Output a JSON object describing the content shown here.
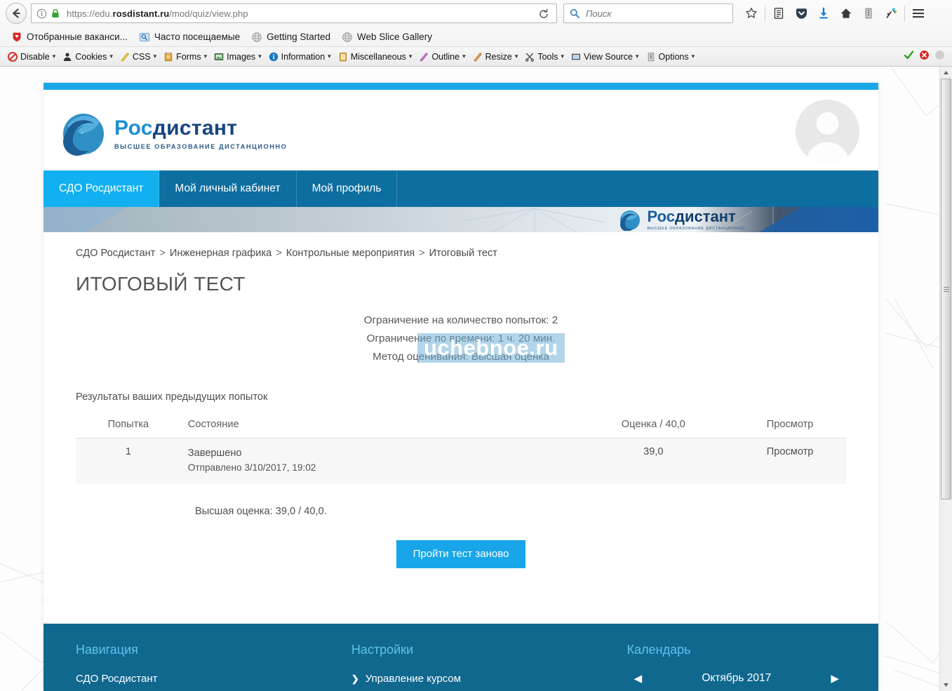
{
  "browser": {
    "back_tooltip": "Назад",
    "url_display_prefix": "https://edu.",
    "url_display_domain": "rosdistant.ru",
    "url_display_suffix": "/mod/quiz/view.php",
    "url_full": "https://edu.rosdistant.ru/mod/quiz/view.php",
    "search_placeholder": "Поиск",
    "reload_icon": "reload-icon",
    "info_icon": "page-info-icon",
    "lock_icon": "lock-icon",
    "search_icon": "search-icon",
    "toolbar_icons": [
      {
        "name": "bookmark-star-icon",
        "label": "Закладки"
      },
      {
        "name": "reading-list-icon",
        "label": "Список для чтения"
      },
      {
        "name": "pocket-icon",
        "label": "Pocket"
      },
      {
        "name": "downloads-icon",
        "label": "Загрузки"
      },
      {
        "name": "home-icon",
        "label": "Домой"
      },
      {
        "name": "library-icon",
        "label": "Библиотека"
      },
      {
        "name": "devtools-icon",
        "label": "Инструменты"
      },
      {
        "name": "hamburger-menu-icon",
        "label": "Меню"
      }
    ],
    "bookmarks": [
      {
        "label": "Отобранные ваканси...",
        "icon": "shield-red-icon"
      },
      {
        "label": "Часто посещаемые",
        "icon": "folder-blue-icon"
      },
      {
        "label": "Getting Started",
        "icon": "globe-icon"
      },
      {
        "label": "Web Slice Gallery",
        "icon": "globe-icon"
      }
    ],
    "devtools": [
      {
        "label": "Disable",
        "icon": "disable-icon",
        "caret": "▾"
      },
      {
        "label": "Cookies",
        "icon": "cookies-icon",
        "caret": "▾"
      },
      {
        "label": "CSS",
        "icon": "css-icon",
        "caret": "▾"
      },
      {
        "label": "Forms",
        "icon": "forms-icon",
        "caret": "▾"
      },
      {
        "label": "Images",
        "icon": "images-icon",
        "caret": "▾"
      },
      {
        "label": "Information",
        "icon": "information-icon",
        "caret": "▾"
      },
      {
        "label": "Miscellaneous",
        "icon": "miscellaneous-icon",
        "caret": "▾"
      },
      {
        "label": "Outline",
        "icon": "outline-icon",
        "caret": "▾"
      },
      {
        "label": "Resize",
        "icon": "resize-icon",
        "caret": "▾"
      },
      {
        "label": "Tools",
        "icon": "tools-icon",
        "caret": "▾"
      },
      {
        "label": "View Source",
        "icon": "view-source-icon",
        "caret": "▾"
      },
      {
        "label": "Options",
        "icon": "options-icon",
        "caret": "▾"
      }
    ],
    "status_icons": [
      {
        "name": "validation-pass-icon",
        "color": "#2f9e28"
      },
      {
        "name": "validation-error-icon",
        "color": "#d8221f"
      },
      {
        "name": "validation-idle-icon",
        "color": "#c9c9c9"
      }
    ]
  },
  "site": {
    "logo": {
      "name_part1": "Рос",
      "name_part2": "дистант",
      "tagline": "ВЫСШЕЕ ОБРАЗОВАНИЕ ДИСТАНЦИОННО"
    },
    "avatar_icon": "user-avatar-icon",
    "tabs": [
      {
        "label": "СДО Росдистант",
        "active": true
      },
      {
        "label": "Мой личный кабинет",
        "active": false
      },
      {
        "label": "Мой профиль",
        "active": false
      }
    ],
    "banner": {
      "name_part1": "Рос",
      "name_part2": "дистант",
      "tagline": "ВЫСШЕЕ ОБРАЗОВАНИЕ ДИСТАНЦИОННО"
    }
  },
  "breadcrumb": [
    "СДО Росдистант",
    "Инженерная графика",
    "Контрольные мероприятия",
    "Итоговый тест"
  ],
  "breadcrumb_separator": ">",
  "page": {
    "title": "ИТОГОВЫЙ ТЕСТ",
    "info_attempts": "Ограничение на количество попыток: 2",
    "info_time": "Ограничение по времени: 1 ч. 20 мин.",
    "info_method": "Метод оценивания: Высшая оценка",
    "results_label": "Результаты ваших предыдущих попыток",
    "best_grade": "Высшая оценка: 39,0 / 40,0.",
    "retake_button": "Пройти тест заново"
  },
  "watermark": {
    "text": "uchebnoe.ru",
    "band_color": "#6eafd7",
    "text_color": "#ffffff"
  },
  "attempts_table": {
    "headers": [
      "Попытка",
      "Состояние",
      "Оценка / 40,0",
      "Просмотр"
    ],
    "rows": [
      {
        "attempt": "1",
        "state_line1": "Завершено",
        "state_line2": "Отправлено 3/10/2017, 19:02",
        "grade": "39,0",
        "review": "Просмотр"
      }
    ]
  },
  "footer": {
    "nav": {
      "heading": "Навигация",
      "items": [
        {
          "label": "СДО Росдистант",
          "chevron": ""
        }
      ]
    },
    "settings": {
      "heading": "Настройки",
      "items": [
        {
          "label": "Управление курсом",
          "chevron": "❯"
        }
      ]
    },
    "calendar": {
      "heading": "Календарь",
      "prev_arrow": "◀",
      "month": "Октябрь 2017",
      "next_arrow": "▶"
    }
  },
  "colors": {
    "accent_blue": "#18a6e8",
    "tab_active": "#12b0f0",
    "tab_bar": "#0d6ea0",
    "footer": "#10688f",
    "footer_heading": "#5ec2ef",
    "topbar": "#1aa7e8"
  }
}
